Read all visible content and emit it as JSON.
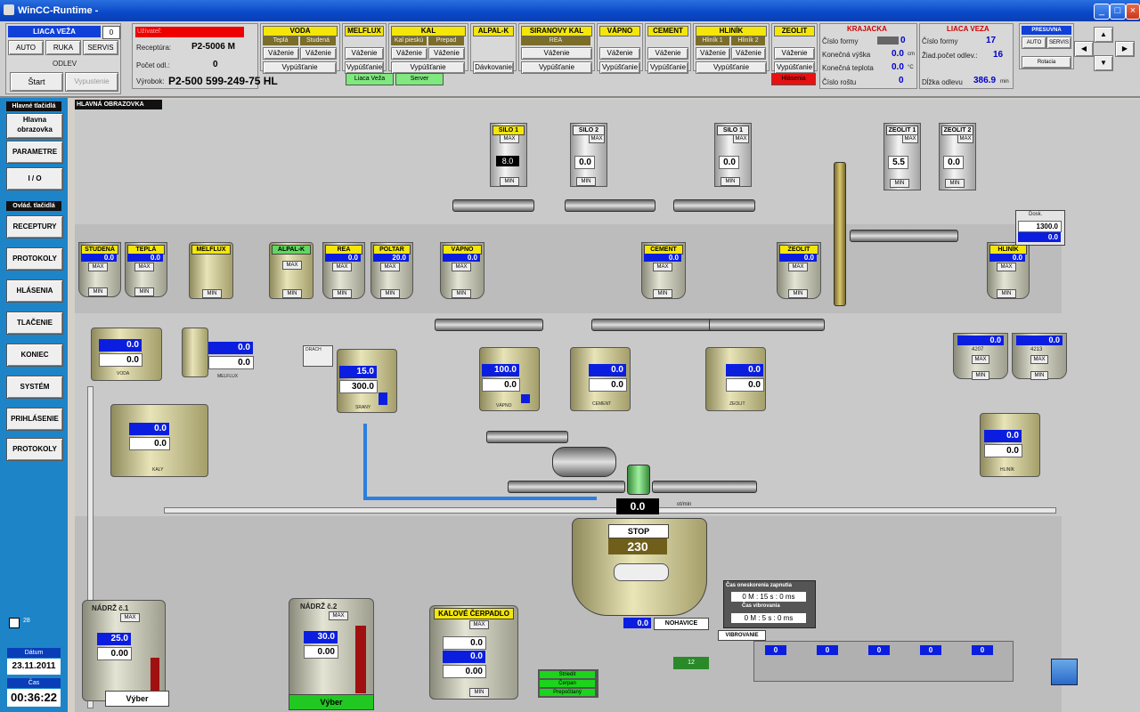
{
  "window": {
    "title": "WinCC-Runtime -"
  },
  "mode": {
    "title": "LIACA VEŽA",
    "indicator": "0",
    "auto": "AUTO",
    "ruka": "RUKA",
    "servis": "SERVIS",
    "odlev": "ODLEV",
    "start": "Štart",
    "vypustenie": "Vypustenie"
  },
  "recipe": {
    "user_label": "Užívateľ:",
    "recipe_label": "Receptúra:",
    "recipe_value": "P2-5006 M",
    "count_label": "Počet odl.:",
    "count_value": "0",
    "product_label": "Výrobok:",
    "product_value": "P2-500 599-249-75 HL"
  },
  "voda": {
    "title": "VODA",
    "a": "Teplá",
    "b": "Studená",
    "w1": "Váženie",
    "w2": "Váženie",
    "out": "Vypúšťanie"
  },
  "melflux": {
    "title": "MELFLUX",
    "w": "Váženie",
    "out": "Vypúšťanie"
  },
  "kal": {
    "title": "KAL",
    "a": "Kal pieskú",
    "b": "Prepad",
    "w1": "Váženie",
    "w2": "Váženie",
    "out": "Vypúšťanie"
  },
  "alpal": {
    "title": "ALPAL-K",
    "out": "Dávkovanie"
  },
  "siranovy": {
    "title": "SIRANOVY KAL",
    "a": "REA",
    "w": "Váženie",
    "out": "Vypúšťanie"
  },
  "vapno": {
    "title": "VÁPNO",
    "w": "Váženie",
    "out": "Vypúšťanie"
  },
  "cement": {
    "title": "CEMENT",
    "w": "Váženie",
    "out": "Vypúšťanie"
  },
  "hlinik": {
    "title": "HLINÍK",
    "a": "Hliník 1",
    "b": "Hliník 2",
    "w1": "Váženie",
    "w2": "Váženie",
    "out": "Vypúšťanie"
  },
  "zeolit": {
    "title": "ZEOLIT",
    "w": "Váženie",
    "out": "Vypúšťanie"
  },
  "status": {
    "liaca": "Liaca Veža",
    "server": "Server",
    "hlasenia": "Hlásenia"
  },
  "krajacka": {
    "title": "KRAJACKA",
    "forma_label": "Číslo formy",
    "forma_value": "0",
    "vyska_label": "Konečná výška",
    "vyska_value": "0.0",
    "vyska_unit": "cm",
    "teplota_label": "Konečná teplota",
    "teplota_value": "0.0",
    "teplota_unit": "°C",
    "rosh_label": "Číslo roštu",
    "rosh_value": "0"
  },
  "liaca": {
    "title": "LIACA VEZA",
    "forma_label": "Číslo formy",
    "forma_value": "17",
    "pocet_label": "Žiad.počet odlev.:",
    "pocet_value": "16",
    "dlzka_label": "Dĺžka odlevu",
    "dlzka_value": "386.9",
    "dlzka_unit": "min"
  },
  "presuvna": {
    "title": "PRESUVNA",
    "auto": "AUTO",
    "servis": "SERVIS",
    "rotacia": "Rotacia"
  },
  "sidebar": {
    "hdr1": "Hlavné tlačidlá",
    "hlavna": "Hlavna obrazovka",
    "parametre": "PARAMETRE",
    "io": "I / O",
    "hdr2": "Ovlád. tlačidlá",
    "receptury": "RECEPTURY",
    "protokoly": "PROTOKOLY",
    "hlasenia": "HLÁSENIA",
    "tlacenie": "TLAČENIE",
    "koniec": "KONIEC",
    "system": "SYSTÉM",
    "prihlasenie": "PRIHLÁSENIE",
    "protokoly2": "PROTOKOLY",
    "datum_label": "Dátum",
    "datum": "23.11.2011",
    "cas_label": "Čas",
    "cas": "00:36:22",
    "small": "28"
  },
  "main": {
    "title": "HLAVNÁ OBRAZOVKA"
  },
  "silos": {
    "s1": {
      "name": "SILO 1",
      "val": "8.0",
      "max": "MAX",
      "min": "MIN"
    },
    "s2": {
      "name": "SILO 2",
      "val": "0.0",
      "max": "MAX",
      "min": "MIN"
    },
    "s3": {
      "name": "SILO 1",
      "val": "0.0",
      "max": "MAX",
      "min": "MIN"
    },
    "z1": {
      "name": "ZEOLIT 1",
      "val": "5.5",
      "max": "MAX",
      "min": "MIN"
    },
    "z2": {
      "name": "ZEOLIT 2",
      "val": "0.0",
      "max": "MAX",
      "min": "MIN"
    }
  },
  "tanks": {
    "studena": {
      "name": "STUDENÁ",
      "v": "0.0"
    },
    "tepla": {
      "name": "TEPLÁ",
      "v": "0.0"
    },
    "melflux": {
      "name": "MELFLUX"
    },
    "alpal": {
      "name": "ALPAL-K"
    },
    "rea": {
      "name": "REA",
      "v": "0.0"
    },
    "poltar": {
      "name": "POLTAR",
      "v": "20.0"
    },
    "vapno": {
      "name": "VÁPNO",
      "v": "0.0"
    },
    "cement": {
      "name": "CEMENT",
      "v": "0.0"
    },
    "zeolit": {
      "name": "ZEOLIT",
      "v": "0.0"
    },
    "hlinik": {
      "name": "HLINÍK",
      "v": "0.0"
    },
    "max": "MAX",
    "min": "MIN"
  },
  "weighers": {
    "voda": {
      "a": "0.0",
      "b": "0.0",
      "name": "VODA"
    },
    "melflux": {
      "a": "0.0",
      "b": "0.0",
      "name": "MELFLUX"
    },
    "kaly": {
      "a": "0.0",
      "b": "0.0",
      "name": "KALY"
    },
    "srany": {
      "a": "15.0",
      "b": "300.0",
      "name": "SRANY"
    },
    "vapno": {
      "a": "100.0",
      "b": "0.0",
      "name": "VÁPNO"
    },
    "cement": {
      "a": "0.0",
      "b": "0.0",
      "name": "CEMENT"
    },
    "zeolit": {
      "a": "0.0",
      "b": "0.0",
      "name": "ZEOLIT"
    },
    "hlinik": {
      "a": "0.0",
      "b": "0.0",
      "name": "HLINÍK"
    },
    "h4207": {
      "a": "0.0",
      "name": "4207"
    },
    "h4213": {
      "a": "0.0",
      "name": "4213"
    }
  },
  "drach": "DRACH",
  "dosky": {
    "label": "Dosk.",
    "value": "1300.0",
    "sub": "0.0"
  },
  "mixer": {
    "flow": "0.0",
    "flow_unit": "ot/min",
    "stop": "STOP",
    "speed": "230",
    "bottom": "0.0",
    "nohavice": "NOHAVICE"
  },
  "timer": {
    "t1": "Čas oneskorenia zapnutia",
    "v1": "0 M : 15 s : 0 ms",
    "t2": "Čas vibrovania",
    "v2": "0 M : 5 s : 0 ms",
    "vibrovanie": "VIBROVANIE"
  },
  "nadrz1": {
    "name": "NÁDRŽ č.1",
    "max": "MAX",
    "a": "25.0",
    "b": "0.00",
    "vyber": "Výber"
  },
  "nadrz2": {
    "name": "NÁDRŽ č.2",
    "max": "MAX",
    "a": "30.0",
    "b": "0.00",
    "vyber": "Výber"
  },
  "kalove": {
    "name": "KALOVÉ ČERPADLO",
    "max": "MAX",
    "a": "0.0",
    "b": "0.0",
    "c": "0.00",
    "min": "MIN"
  },
  "pump_legend": {
    "a": "Striedit",
    "b": "Čerpan",
    "c": "Prepočitaný"
  },
  "vib_vals": [
    "0",
    "0",
    "0",
    "0",
    "0"
  ],
  "car": "12"
}
